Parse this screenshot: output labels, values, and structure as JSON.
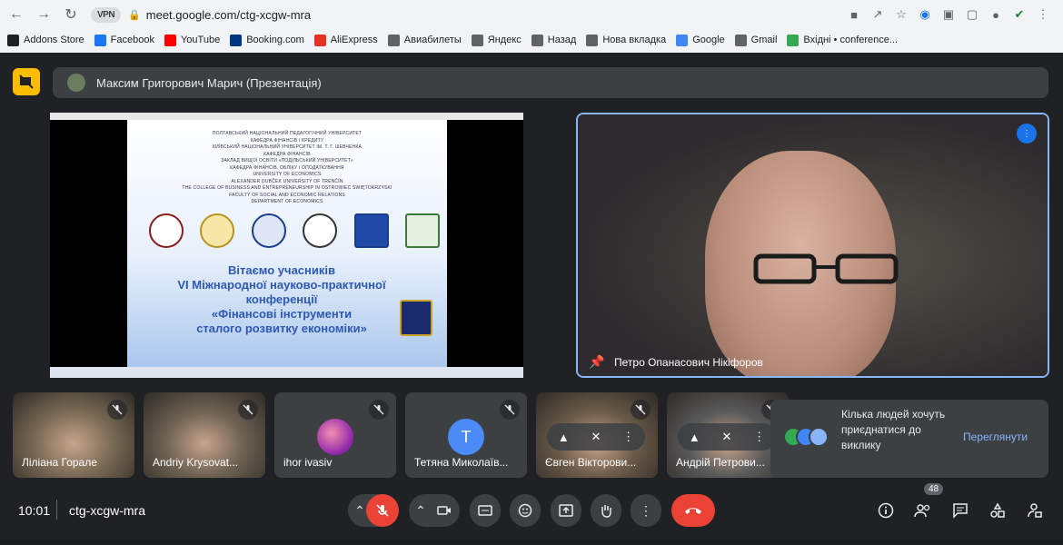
{
  "browser": {
    "url": "meet.google.com/ctg-xcgw-mra",
    "vpn_label": "VPN",
    "bookmarks": [
      {
        "label": "Addons Store",
        "color": "#202124"
      },
      {
        "label": "Facebook",
        "color": "#1877f2"
      },
      {
        "label": "YouTube",
        "color": "#ff0000"
      },
      {
        "label": "Booking.com",
        "color": "#003580"
      },
      {
        "label": "AliExpress",
        "color": "#e43225"
      },
      {
        "label": "Авиабилеты",
        "color": "#5f6368"
      },
      {
        "label": "Яндекс",
        "color": "#5f6368"
      },
      {
        "label": "Назад",
        "color": "#5f6368"
      },
      {
        "label": "Нова вкладка",
        "color": "#5f6368"
      },
      {
        "label": "Google",
        "color": "#4285f4"
      },
      {
        "label": "Gmail",
        "color": "#5f6368"
      },
      {
        "label": "Вхідні • conference...",
        "color": "#34a853"
      }
    ]
  },
  "meet": {
    "presenter_bar": "Максим Григорович Марич (Презентація)",
    "speaker_name": "Петро Опанасович Нікіфоров",
    "slide": {
      "affiliations": [
        "ПОЛТАВСЬКИЙ НАЦІОНАЛЬНИЙ ПЕДАГОГІЧНИЙ УНІВЕРСИТЕТ",
        "КАФЕДРА ФІНАНСІВ І КРЕДИТУ",
        "КИЇВСЬКИЙ НАЦІОНАЛЬНИЙ УНІВЕРСИТЕТ ІМ. Т. Г. ШЕВЧЕНКА",
        "КАФЕДРА ФІНАНСІВ",
        "ЗАКЛАД ВИЩОЇ ОСВІТИ «ПОДІЛЬСЬКИЙ УНІВЕРСИТЕТ»",
        "КАФЕДРА ФІНАНСІВ, ОБЛІКУ І ОПОДАТКУВАННЯ",
        "UNIVERSITY OF ECONOMICS",
        "ALEXANDER DUBČEK UNIVERSITY OF TRENČÍN",
        "THE COLLEGE OF BUSINESS AND ENTREPRENEURSHIP IN OSTROWIEC ŚWIĘTOKRZYSKI",
        "FACULTY OF SOCIAL AND ECONOMIC RELATIONS",
        "DEPARTMENT OF ECONOMICS"
      ],
      "title_lines": [
        "Вітаємо учасників",
        "VI Міжнародної науково-практичної",
        "конференції",
        "«Фінансові інструменти",
        "сталого розвитку економіки»"
      ]
    },
    "participants": [
      {
        "name": "Ліліана Горале",
        "type": "photo",
        "photo_color": "#7a6a55"
      },
      {
        "name": "Andriy Krysovat...",
        "type": "photo",
        "photo_color": "#6e6253"
      },
      {
        "name": "ihor ivasiv",
        "type": "avatar-image"
      },
      {
        "name": "Тетяна Миколаїв...",
        "type": "letter",
        "letter": "Т"
      },
      {
        "name": "Євген Вікторови...",
        "type": "photo",
        "photo_color": "#6b5b49"
      },
      {
        "name": "Андрій Петрови...",
        "type": "photo",
        "photo_color": "#5a5a5a"
      }
    ],
    "join_request": {
      "text": "Кілька людей хочуть приєднатися до виклику",
      "action": "Переглянути"
    },
    "bottom": {
      "time": "10:01",
      "meeting_code": "ctg-xcgw-mra",
      "people_count": "48"
    }
  }
}
